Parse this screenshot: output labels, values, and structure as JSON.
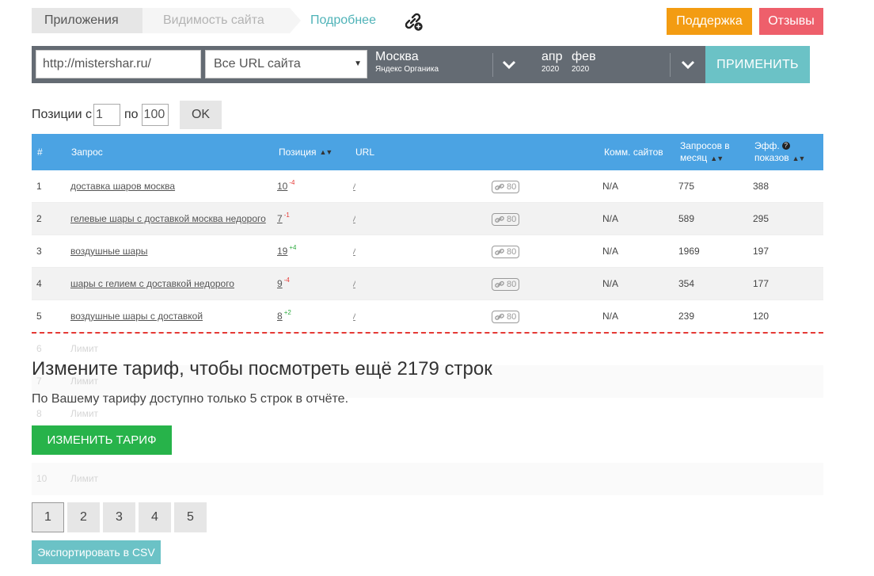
{
  "breadcrumb": {
    "first": "Приложения",
    "second": "Видимость сайта",
    "more": "Подробнее"
  },
  "header_buttons": {
    "support": "Поддержка",
    "reviews": "Отзывы"
  },
  "colors": {
    "support": "#f39c12",
    "reviews": "#ee5f6b",
    "apply": "#6bc2c6",
    "table_header": "#4ba3e3",
    "upgrade": "#27b34a",
    "limit_line": "#e53935"
  },
  "filters": {
    "site_value": "http://mistershar.ru/",
    "url_scope": "Все URL сайта",
    "region": {
      "city": "Москва",
      "engine": "Яндекс Органика"
    },
    "month_from": {
      "month": "апр",
      "year": "2020"
    },
    "month_to": {
      "month": "фев",
      "year": "2020"
    },
    "apply_label": "ПРИМЕНИТЬ"
  },
  "positions": {
    "from_label": "Позиции с",
    "from_value": "1",
    "to_label": "по",
    "to_value": "100",
    "ok_label": "OK"
  },
  "table": {
    "headers": {
      "num": "#",
      "query": "Запрос",
      "position": "Позиция",
      "url": "URL",
      "competitors": "Комм. сайтов",
      "requests_line1": "Запросов в",
      "requests_line2": "месяц",
      "eff_line1": "Эфф.",
      "eff_line2": "показов"
    },
    "rows": [
      {
        "num": "1",
        "query": "доставка шаров москва",
        "position": "10",
        "delta": "-4",
        "url": "/",
        "links": "80",
        "competitors": "N/A",
        "requests": "775",
        "eff": "388"
      },
      {
        "num": "2",
        "query": "гелевые шары с доставкой москва недорого",
        "position": "7",
        "delta": "-1",
        "url": "/",
        "links": "80",
        "competitors": "N/A",
        "requests": "589",
        "eff": "295"
      },
      {
        "num": "3",
        "query": "воздушные шары",
        "position": "19",
        "delta": "+4",
        "url": "/",
        "links": "80",
        "competitors": "N/A",
        "requests": "1969",
        "eff": "197"
      },
      {
        "num": "4",
        "query": "шары с гелием с доставкой недорого",
        "position": "9",
        "delta": "-4",
        "url": "/",
        "links": "80",
        "competitors": "N/A",
        "requests": "354",
        "eff": "177"
      },
      {
        "num": "5",
        "query": "воздушные шары с доставкой",
        "position": "8",
        "delta": "+2",
        "url": "/",
        "links": "80",
        "competitors": "N/A",
        "requests": "239",
        "eff": "120"
      }
    ],
    "locked_rows": [
      {
        "num": "6",
        "label": "Лимит"
      },
      {
        "num": "7",
        "label": "Лимит"
      },
      {
        "num": "8",
        "label": "Лимит"
      },
      {
        "num": "10",
        "label": "Лимит"
      }
    ]
  },
  "upsell": {
    "title": "Измените тариф, чтобы посмотреть ещё 2179 строк",
    "text": "По Вашему тарифу доступно только 5 строк в отчёте.",
    "button": "ИЗМЕНИТЬ ТАРИФ"
  },
  "pagination": {
    "pages": [
      "1",
      "2",
      "3",
      "4",
      "5"
    ],
    "active": "1"
  },
  "export_label": "Экспортировать в CSV"
}
